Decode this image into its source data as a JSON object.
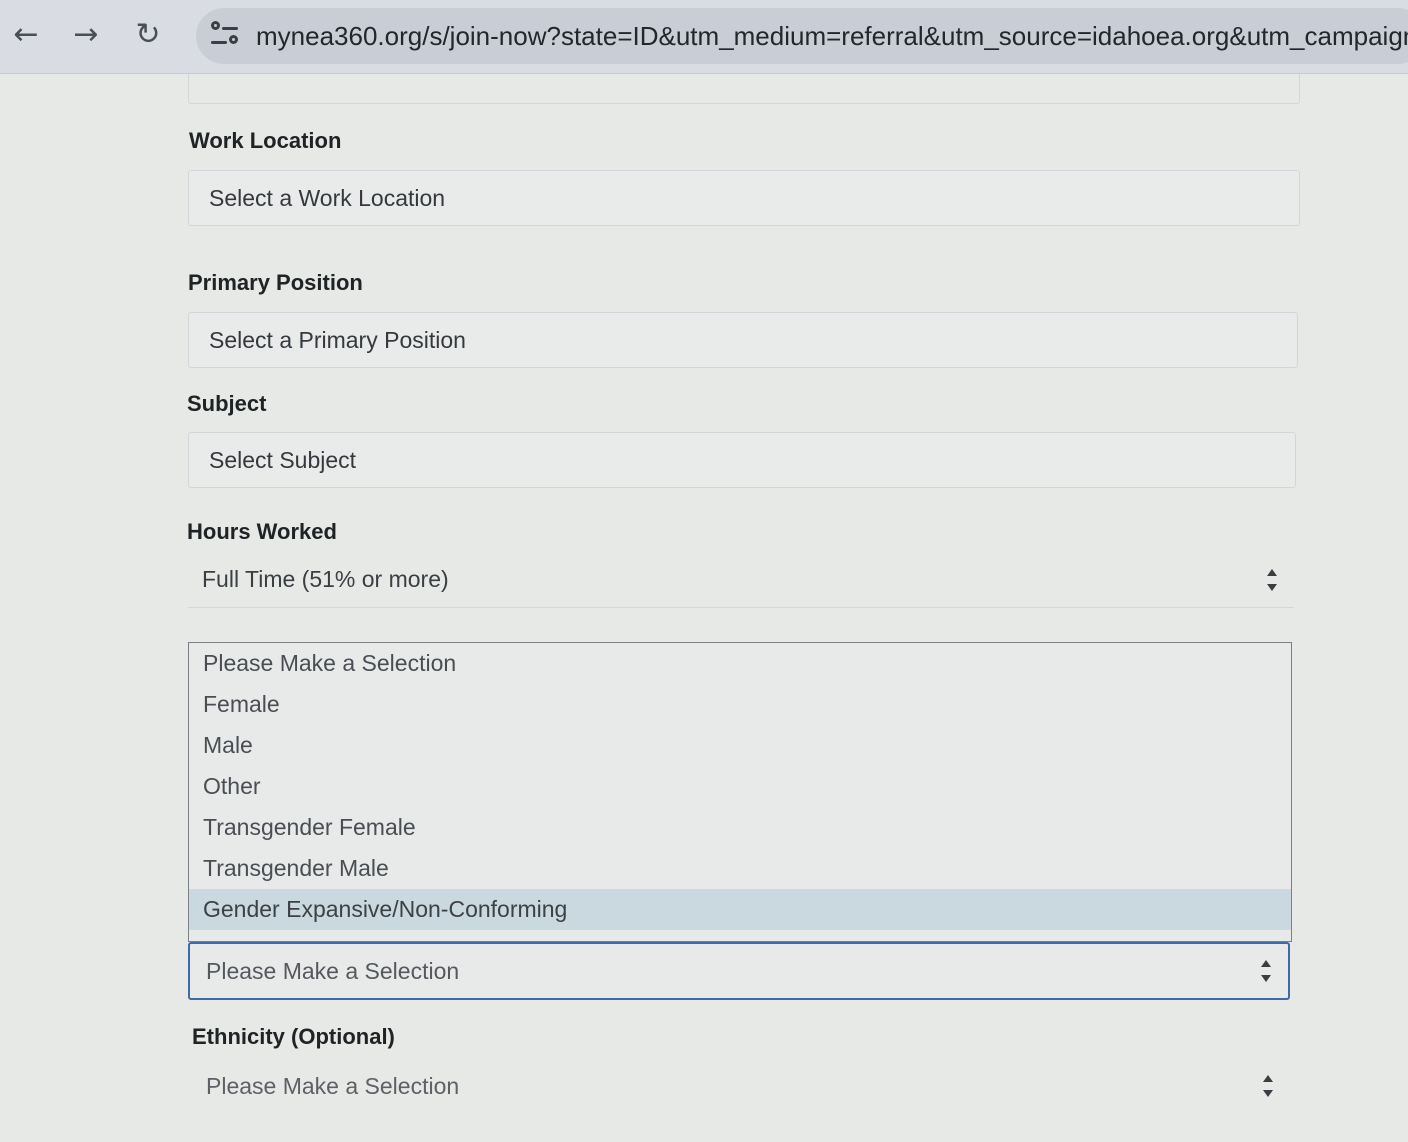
{
  "browser": {
    "url": "mynea360.org/s/join-now?state=ID&utm_medium=referral&utm_source=idahoea.org&utm_campaign=un"
  },
  "form": {
    "work_location": {
      "label": "Work Location",
      "value": "Select a Work Location"
    },
    "primary_position": {
      "label": "Primary Position",
      "value": "Select a Primary Position"
    },
    "subject": {
      "label": "Subject",
      "value": "Select Subject"
    },
    "hours_worked": {
      "label": "Hours Worked",
      "value": "Full Time (51% or more)"
    },
    "gender": {
      "options": [
        "Please Make a Selection",
        "Female",
        "Male",
        "Other",
        "Transgender Female",
        "Transgender Male",
        "Gender Expansive/Non-Conforming"
      ],
      "highlighted_option": "Gender Expansive/Non-Conforming",
      "value": "Please Make a Selection"
    },
    "ethnicity": {
      "label": "Ethnicity (Optional)",
      "value": "Please Make a Selection"
    }
  },
  "colors": {
    "focus_border": "#3f6aa7",
    "highlight": "#c9d9df"
  }
}
